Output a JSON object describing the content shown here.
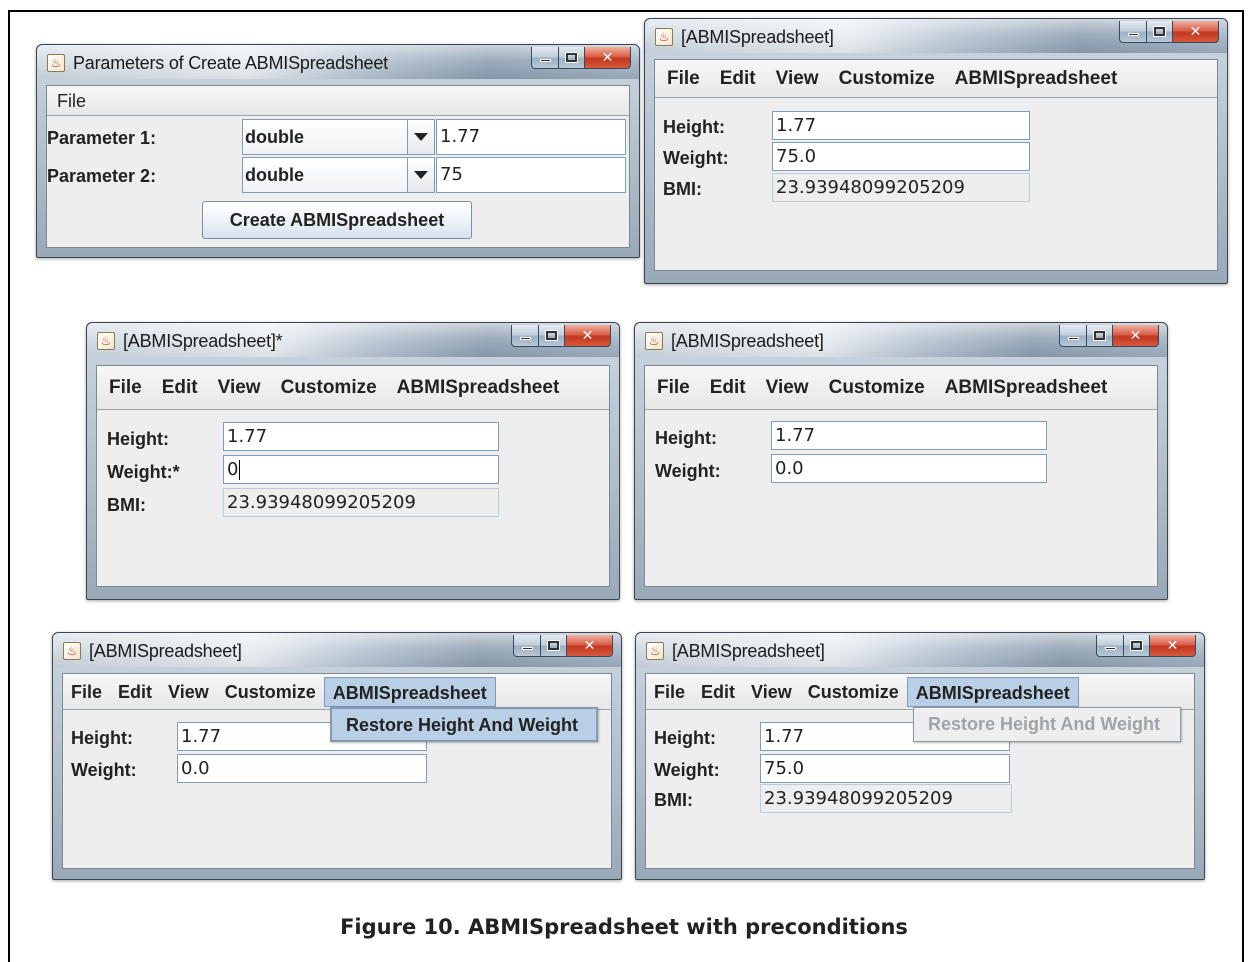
{
  "caption": "Figure 10. ABMISpreadsheet with preconditions",
  "icons": {
    "app": "java-cup-icon",
    "minimize": "minimize-icon",
    "maximize": "maximize-icon",
    "close": "close-icon",
    "dropdown": "chevron-down-icon"
  },
  "params_window": {
    "title": "Parameters of Create  ABMISpreadsheet",
    "menu": [
      "File"
    ],
    "param1_label": "Parameter 1:",
    "param1_type": "double",
    "param1_value": "1.77",
    "param2_label": "Parameter 2:",
    "param2_type": "double",
    "param2_value": "75",
    "create_button": "Create  ABMISpreadsheet"
  },
  "menu_labels": [
    "File",
    "Edit",
    "View",
    "Customize",
    "ABMISpreadsheet"
  ],
  "win_a": {
    "title": "[ABMISpreadsheet]",
    "height_label": "Height:",
    "height": "1.77",
    "weight_label": "Weight:",
    "weight": "75.0",
    "bmi_label": "BMI:",
    "bmi": "23.93948099205209"
  },
  "win_b": {
    "title": "[ABMISpreadsheet]*",
    "height_label": "Height:",
    "height": "1.77",
    "weight_label": "Weight:*",
    "weight": "0",
    "bmi_label": "BMI:",
    "bmi": "23.93948099205209"
  },
  "win_c": {
    "title": "[ABMISpreadsheet]",
    "height_label": "Height:",
    "height": "1.77",
    "weight_label": "Weight:",
    "weight": "0.0"
  },
  "win_d": {
    "title": "[ABMISpreadsheet]",
    "height_label": "Height:",
    "height": "1.77",
    "weight_label": "Weight:",
    "weight": "0.0",
    "dropdown_item": "Restore Height And Weight"
  },
  "win_e": {
    "title": "[ABMISpreadsheet]",
    "height_label": "Height:",
    "height": "1.77",
    "weight_label": "Weight:",
    "weight": "75.0",
    "bmi_label": "BMI:",
    "bmi": "23.93948099205209",
    "dropdown_item": "Restore Height And Weight"
  }
}
